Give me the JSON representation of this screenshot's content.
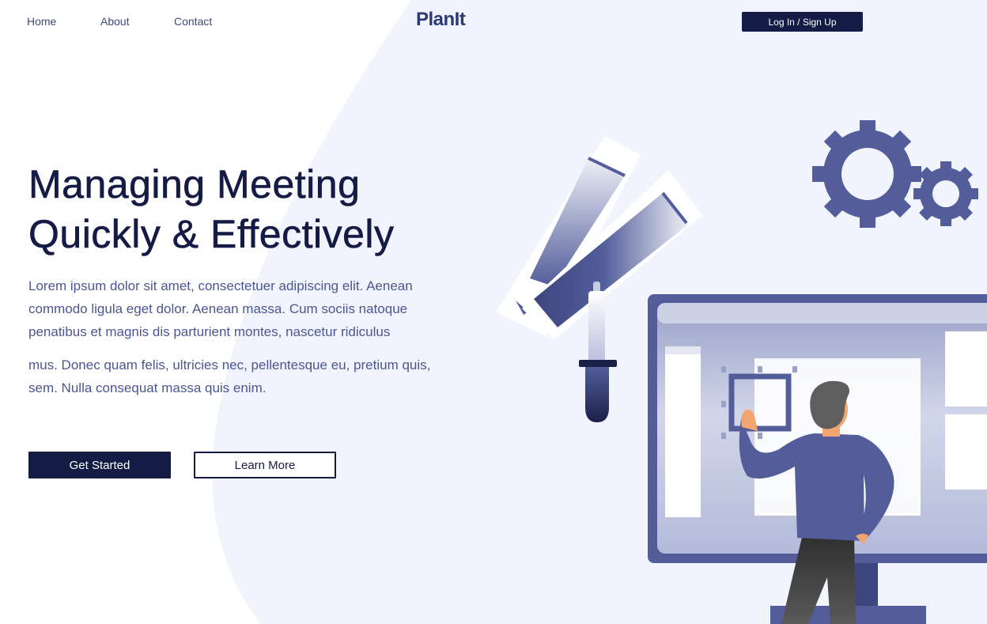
{
  "nav": {
    "links": [
      {
        "label": "Home"
      },
      {
        "label": "About"
      },
      {
        "label": "Contact"
      }
    ],
    "brand": "PlanIt",
    "auth_button": "Log In / Sign Up"
  },
  "hero": {
    "title_line1": "Managing Meeting",
    "title_line2": "Quickly & Effectively",
    "paragraph1": "Lorem ipsum dolor sit amet, consectetuer adipiscing elit. Aenean commodo ligula eget dolor. Aenean massa. Cum sociis natoque penatibus et magnis dis parturient montes, nascetur ridiculus",
    "paragraph2": "mus. Donec quam felis, ultricies nec, pellentesque eu, pretium quis, sem. Nulla consequat massa quis enim.",
    "primary_button": "Get Started",
    "secondary_button": "Learn More"
  },
  "illustration": {
    "icons": [
      "color-swatch-icon",
      "eyedropper-icon",
      "gear-icon",
      "monitor-icon",
      "person-icon"
    ]
  },
  "colors": {
    "navy": "#141b45",
    "accent": "#525d9a",
    "text": "#4c5690",
    "background_shape": "#f1f4fd"
  }
}
